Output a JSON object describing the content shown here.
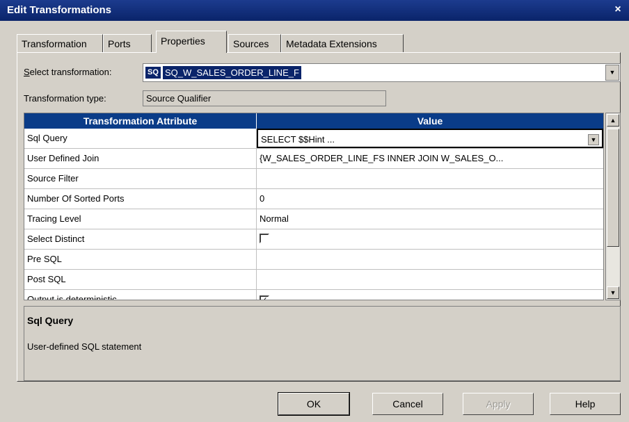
{
  "window": {
    "title": "Edit Transformations",
    "close": "×"
  },
  "tabs": [
    {
      "label": "Transformation"
    },
    {
      "label": "Ports"
    },
    {
      "label": "Properties"
    },
    {
      "label": "Sources"
    },
    {
      "label": "Metadata Extensions"
    }
  ],
  "active_tab": "Properties",
  "select_transformation": {
    "label_u": "S",
    "label_rest": "elect transformation:",
    "icon_text": "SQ",
    "value": "SQ_W_SALES_ORDER_LINE_F"
  },
  "transformation_type": {
    "label": "Transformation type:",
    "value": "Source Qualifier"
  },
  "grid": {
    "headers": {
      "attribute": "Transformation Attribute",
      "value": "Value"
    },
    "rows": [
      {
        "attribute": "Sql Query",
        "value": "SELECT  $$Hint ..."
      },
      {
        "attribute": "User Defined Join",
        "value": "{W_SALES_ORDER_LINE_FS INNER JOIN W_SALES_O..."
      },
      {
        "attribute": "Source Filter",
        "value": ""
      },
      {
        "attribute": "Number Of Sorted Ports",
        "value": "0"
      },
      {
        "attribute": "Tracing Level",
        "value": "Normal"
      },
      {
        "attribute": "Select Distinct",
        "value": ""
      },
      {
        "attribute": "Pre SQL",
        "value": ""
      },
      {
        "attribute": "Post SQL",
        "value": ""
      },
      {
        "attribute": "Output is deterministic",
        "value": ""
      }
    ]
  },
  "description": {
    "title": "Sql Query",
    "text": "User-defined SQL statement"
  },
  "buttons": {
    "ok": "OK",
    "cancel": "Cancel",
    "apply": "Apply",
    "help": "Help"
  }
}
